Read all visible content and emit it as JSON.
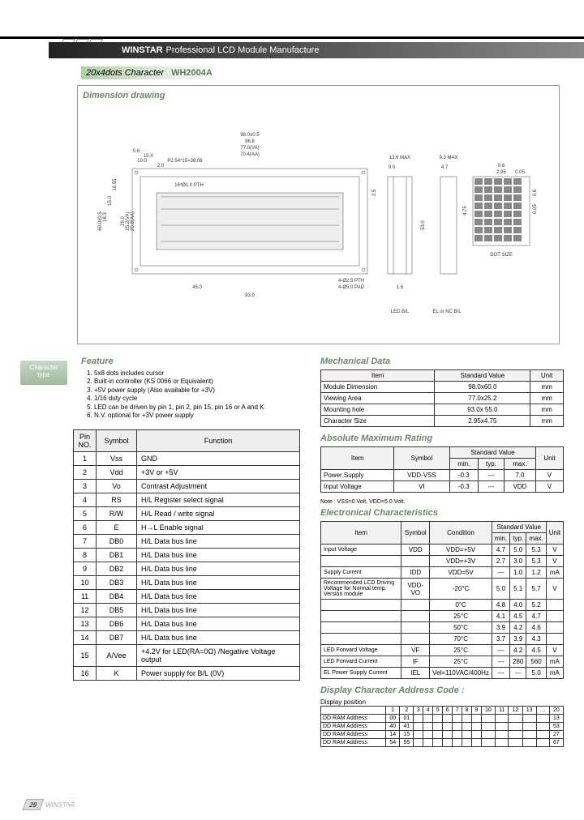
{
  "header": {
    "brand": "WINSTAR",
    "tagline": "Professional LCD Module Manufacture"
  },
  "subhead": {
    "spec": "20x4dots Character",
    "model": "WH2004A"
  },
  "sections": {
    "dimension": "Dimension drawing",
    "feature": "Feature",
    "mechanical": "Mechanical Data",
    "absmax": "Absolute Maximum Rating",
    "electrical": "Electronical Characteristics",
    "addr": "Display Character Address Code :"
  },
  "char_badge": {
    "line1": "Character",
    "line2": "type"
  },
  "drawing_labels": {
    "d1": "98.0±0.5",
    "d2": "96.8",
    "d3": "77.0(VA)",
    "d4": "70.4(AA)",
    "d5": "0.6",
    "d6": "15.X",
    "d7": "10.0",
    "d8": "P2.54*15=38.06",
    "d9": "2.0",
    "d10": "13.6 MAX",
    "d11": "9.3 MAX",
    "d12": "9.0",
    "d13": "4.7",
    "d14": "2.5",
    "d15": "10.55",
    "d16": "15.0",
    "d17": "18.3",
    "d18": "60.0±0.5",
    "d19": "29.0",
    "d20": "25.2(VA)",
    "d21": "20.8(AA)",
    "d22": "4.75",
    "d23": "16*Ø1.0 PTH",
    "d24": "45.0",
    "d25": "93.0",
    "d26": "4-Ø2.5 PTH",
    "d27": "4-Ø5.0 PAD",
    "d28": "1.6",
    "d29": "53.0",
    "bl1": "LED B/L",
    "bl2": "EL or NC B/L",
    "dot1": "0.6",
    "dot2": "2.95",
    "dot3": "0.05",
    "dot4": "0.6",
    "dot5": "0.05",
    "dot6": "4.75",
    "dotlabel": "DOT SIZE"
  },
  "features": [
    "5x8 dots includes cursor",
    "Built-in controller (KS 0066 or Equivalent)",
    "+5V power supply (Also available for +3V)",
    "1/16 duty cycle",
    "LED can be driven by pin 1, pin 2, pin 15, pin 16 or A and K",
    "N.V. optional for +3V power supply"
  ],
  "pin_header": {
    "no": "Pin NO.",
    "symbol": "Symbol",
    "function": "Function"
  },
  "pins": [
    {
      "no": "1",
      "sym": "Vss",
      "func": "GND"
    },
    {
      "no": "2",
      "sym": "Vdd",
      "func": "+3V or +5V"
    },
    {
      "no": "3",
      "sym": "Vo",
      "func": "Contrast Adjustment"
    },
    {
      "no": "4",
      "sym": "RS",
      "func": "H/L Register select signal"
    },
    {
      "no": "5",
      "sym": "R/W",
      "func": "H/L Read / write signal"
    },
    {
      "no": "6",
      "sym": "E",
      "func": "H→L Enable signal"
    },
    {
      "no": "7",
      "sym": "DB0",
      "func": "H/L Data bus line"
    },
    {
      "no": "8",
      "sym": "DB1",
      "func": "H/L Data bus line"
    },
    {
      "no": "9",
      "sym": "DB2",
      "func": "H/L Data bus line"
    },
    {
      "no": "10",
      "sym": "DB3",
      "func": "H/L Data bus line"
    },
    {
      "no": "11",
      "sym": "DB4",
      "func": "H/L Data bus line"
    },
    {
      "no": "12",
      "sym": "DB5",
      "func": "H/L Data bus line"
    },
    {
      "no": "13",
      "sym": "DB6",
      "func": "H/L Data bus line"
    },
    {
      "no": "14",
      "sym": "DB7",
      "func": "H/L Data bus line"
    },
    {
      "no": "15",
      "sym": "A/Vee",
      "func": "+4.2V for LED(RA=0Ω) /Negative Voltage output"
    },
    {
      "no": "16",
      "sym": "K",
      "func": "Power supply for B/L (0V)"
    }
  ],
  "mech_header": {
    "item": "Item",
    "std": "Standard Value",
    "unit": "Unit"
  },
  "mech": [
    {
      "item": "Module Dimension",
      "std": "98.0x60.0",
      "unit": "mm"
    },
    {
      "item": "Viewing Area",
      "std": "77.0x25.2",
      "unit": "mm"
    },
    {
      "item": "Mounting hole",
      "std": "93.0x 55.0",
      "unit": "mm"
    },
    {
      "item": "Character Size",
      "std": "2.95x4.75",
      "unit": "mm"
    }
  ],
  "abs_header": {
    "item": "Item",
    "symbol": "Symbol",
    "min": "min.",
    "typ": "typ.",
    "max": "max.",
    "unit": "Unit",
    "std": "Standard Value"
  },
  "abs": [
    {
      "item": "Power Supply",
      "sym": "VDD-VSS",
      "min": "-0.3",
      "typ": "---",
      "max": "7.0",
      "unit": "V"
    },
    {
      "item": "Input Voltage",
      "sym": "VI",
      "min": "-0.3",
      "typ": "---",
      "max": "VDD",
      "unit": "V"
    }
  ],
  "abs_note": "Note : VSS=0 Volt, VDD=5.0 Volt.",
  "elec_header": {
    "item": "Item",
    "symbol": "Symbol",
    "cond": "Condition",
    "min": "min.",
    "typ": "typ.",
    "max": "max.",
    "unit": "Unit",
    "std": "Standard Value"
  },
  "elec": [
    {
      "item": "Input Voltage",
      "sym": "VDD",
      "cond": "VDD=+5V",
      "min": "4.7",
      "typ": "5.0",
      "max": "5.3",
      "unit": "V"
    },
    {
      "item": "",
      "sym": "",
      "cond": "VDD=+3V",
      "min": "2.7",
      "typ": "3.0",
      "max": "5.3",
      "unit": "V"
    },
    {
      "item": "Supply Current",
      "sym": "IDD",
      "cond": "VDD=5V",
      "min": "---",
      "typ": "1.0",
      "max": "1.2",
      "unit": "mA"
    },
    {
      "item": "Recommended LCD Driving Voltage for Normal temp. Version module",
      "sym": "VDD-VO",
      "cond": "-20°C",
      "min": "5.0",
      "typ": "5.1",
      "max": "5.7",
      "unit": "V"
    },
    {
      "item": "",
      "sym": "",
      "cond": "0°C",
      "min": "4.8",
      "typ": "4.0",
      "max": "5.2",
      "unit": ""
    },
    {
      "item": "",
      "sym": "",
      "cond": "25°C",
      "min": "4.1",
      "typ": "4.5",
      "max": "4.7",
      "unit": ""
    },
    {
      "item": "",
      "sym": "",
      "cond": "50°C",
      "min": "3.9",
      "typ": "4.2",
      "max": "4.6",
      "unit": ""
    },
    {
      "item": "",
      "sym": "",
      "cond": "70°C",
      "min": "3.7",
      "typ": "3.9",
      "max": "4.3",
      "unit": ""
    },
    {
      "item": "LED Forward Voltage",
      "sym": "VF",
      "cond": "25°C",
      "min": "---",
      "typ": "4.2",
      "max": "4.5",
      "unit": "V"
    },
    {
      "item": "LED Forward Current",
      "sym": "IF",
      "cond": "25°C",
      "min": "---",
      "typ": "280",
      "max": "560",
      "unit": "mA"
    },
    {
      "item": "EL Power Supply Current",
      "sym": "IEL",
      "cond": "Vel=110VAC/400Hz",
      "min": "---",
      "typ": "---",
      "max": "5.0",
      "unit": "mA"
    }
  ],
  "addr_label": "Display position",
  "addr_cols": [
    "1",
    "2",
    "3",
    "4",
    "5",
    "6",
    "7",
    "8",
    "9",
    "10",
    "11",
    "12",
    "13",
    "…",
    "20"
  ],
  "addr_rows": [
    {
      "label": "DD RAM Address",
      "first": "00",
      "second": "01",
      "last": "13"
    },
    {
      "label": "DD RAM Address",
      "first": "40",
      "second": "41",
      "last": "53"
    },
    {
      "label": "DD RAM Address",
      "first": "14",
      "second": "15",
      "last": "27"
    },
    {
      "label": "DD RAM Address",
      "first": "54",
      "second": "55",
      "last": "67"
    }
  ],
  "page_num": "29",
  "footer_brand": "WINSTAR"
}
